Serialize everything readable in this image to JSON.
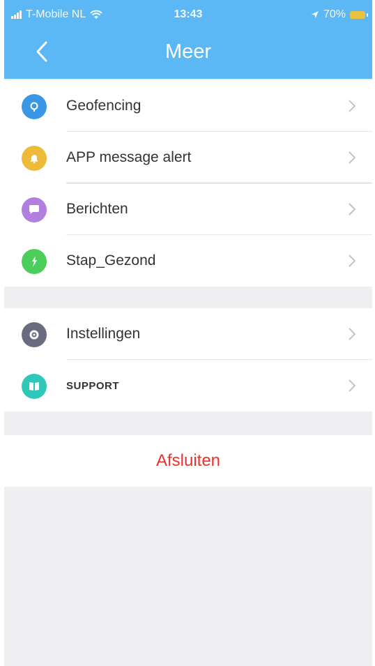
{
  "status_bar": {
    "carrier": "T-Mobile NL",
    "time": "13:43",
    "battery": "70%"
  },
  "header": {
    "title": "Meer",
    "back_icon": "chevron-left-icon"
  },
  "colors": {
    "header": "#5cb7f5",
    "logout": "#e8332b",
    "geofencing_icon": "#3a97e6",
    "alert_icon": "#edba3a",
    "berichten_icon": "#b07fe0",
    "stap_icon": "#4ccf5a",
    "instellingen_icon": "#6b6b80",
    "support_icon": "#2fc8b8"
  },
  "menu_group_1": [
    {
      "label": "Geofencing",
      "icon": "location-pin-icon"
    },
    {
      "label": "APP message alert",
      "icon": "bell-icon"
    },
    {
      "label": "Berichten",
      "icon": "chat-icon"
    },
    {
      "label": "Stap_Gezond",
      "icon": "footstep-icon"
    }
  ],
  "menu_group_2": [
    {
      "label": "Instellingen",
      "icon": "gear-icon"
    },
    {
      "label": "SUPPORT",
      "icon": "support-icon"
    }
  ],
  "logout_label": "Afsluiten"
}
